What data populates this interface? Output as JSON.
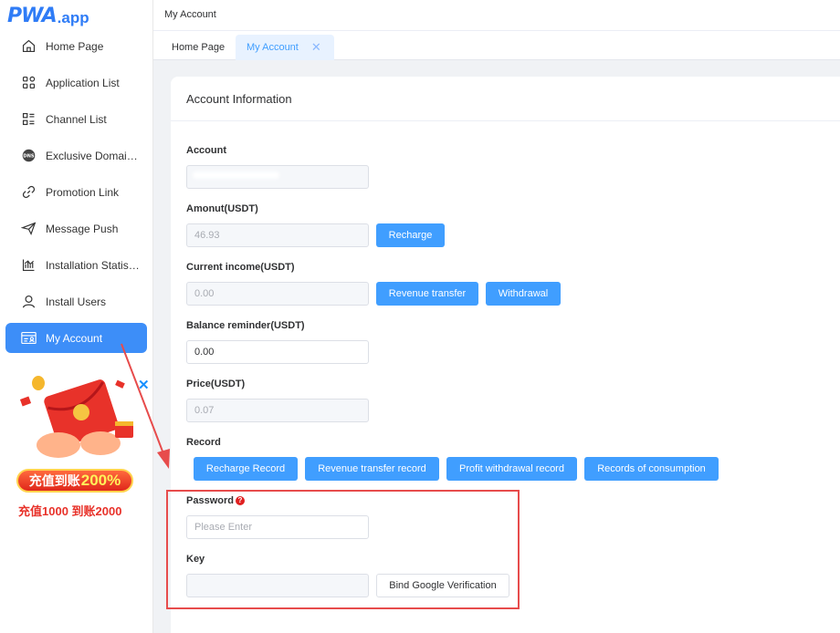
{
  "logo": {
    "main": "PWA",
    "sub": ".app"
  },
  "sidebar": {
    "items": [
      {
        "label": "Home Page",
        "icon": "home-icon"
      },
      {
        "label": "Application List",
        "icon": "apps-icon"
      },
      {
        "label": "Channel List",
        "icon": "list-icon"
      },
      {
        "label": "Exclusive Domain Name",
        "icon": "dns-icon"
      },
      {
        "label": "Promotion Link",
        "icon": "link-icon"
      },
      {
        "label": "Message Push",
        "icon": "send-icon"
      },
      {
        "label": "Installation Statistics",
        "icon": "chart-icon"
      },
      {
        "label": "Install Users",
        "icon": "user-icon"
      },
      {
        "label": "My Account",
        "icon": "account-card-icon",
        "active": true
      }
    ]
  },
  "ad": {
    "banner_main": "充值到账",
    "banner_percent": "200%",
    "sub": "充值1000 到账2000"
  },
  "header": {
    "breadcrumb": "My Account"
  },
  "tabs": [
    {
      "label": "Home Page"
    },
    {
      "label": "My Account",
      "active": true
    }
  ],
  "card": {
    "title": "Account Information",
    "account": {
      "label": "Account",
      "value": ""
    },
    "amount": {
      "label": "Amonut(USDT)",
      "value": "46.93",
      "recharge_button": "Recharge"
    },
    "income": {
      "label": "Current income(USDT)",
      "value": "0.00",
      "transfer_button": "Revenue transfer",
      "withdrawal_button": "Withdrawal"
    },
    "balance_reminder": {
      "label": "Balance reminder(USDT)",
      "value": "0.00"
    },
    "price": {
      "label": "Price(USDT)",
      "value": "0.07"
    },
    "record": {
      "label": "Record",
      "buttons": [
        "Recharge Record",
        "Revenue transfer record",
        "Profit withdrawal record",
        "Records of consumption"
      ]
    },
    "password": {
      "label": "Password",
      "required_mark": "?",
      "placeholder": "Please Enter"
    },
    "key": {
      "label": "Key",
      "value": "",
      "bind_button": "Bind Google Verification"
    }
  },
  "colors": {
    "primary": "#409eff",
    "sidebar_active": "#3d8ef8",
    "highlight": "#e74c4c"
  }
}
